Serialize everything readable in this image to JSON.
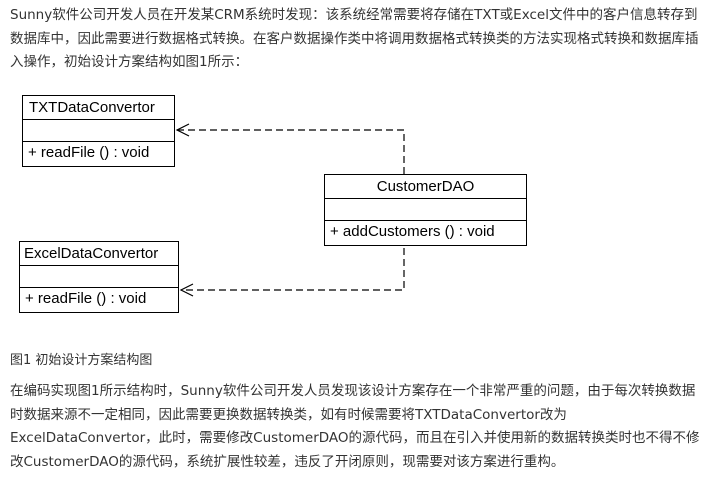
{
  "intro_text": "Sunny软件公司开发人员在开发某CRM系统时发现：该系统经常需要将存储在TXT或Excel文件中的客户信息转存到数据库中，因此需要进行数据格式转换。在客户数据操作类中将调用数据格式转换类的方法实现格式转换和数据库插入操作，初始设计方案结构如图1所示：",
  "diagram": {
    "classes": [
      {
        "id": "txt",
        "name": "TXTDataConvertor",
        "operation": "+ readFile () : void"
      },
      {
        "id": "excel",
        "name": "ExcelDataConvertor",
        "operation": "+ readFile () : void"
      },
      {
        "id": "dao",
        "name": "CustomerDAO",
        "operation": "+ addCustomers () : void"
      }
    ],
    "relations": [
      {
        "from": "CustomerDAO",
        "to": "TXTDataConvertor",
        "type": "dependency"
      },
      {
        "from": "CustomerDAO",
        "to": "ExcelDataConvertor",
        "type": "dependency"
      }
    ]
  },
  "caption": "图1 初始设计方案结构图",
  "outro_text": "在编码实现图1所示结构时，Sunny软件公司开发人员发现该设计方案存在一个非常严重的问题，由于每次转换数据时数据来源不一定相同，因此需要更换数据转换类，如有时候需要将TXTDataConvertor改为ExcelDataConvertor，此时，需要修改CustomerDAO的源代码，而且在引入并使用新的数据转换类时也不得不修改CustomerDAO的源代码，系统扩展性较差，违反了开闭原则，现需要对该方案进行重构。"
}
